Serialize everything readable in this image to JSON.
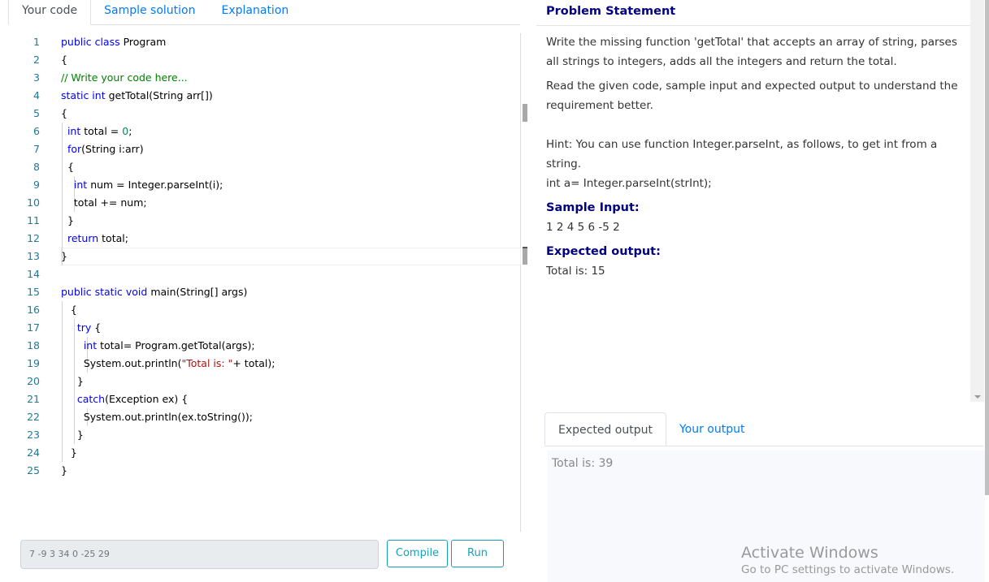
{
  "tabs": [
    "Your code",
    "Sample solution",
    "Explanation"
  ],
  "code": [
    [
      [
        "kw",
        "public class "
      ],
      [
        "pl",
        "Program"
      ]
    ],
    [
      [
        "pl",
        "{"
      ]
    ],
    [
      [
        "cm",
        "// Write your code here..."
      ]
    ],
    [
      [
        "kw",
        "static int "
      ],
      [
        "pl",
        "getTotal(String arr[])"
      ]
    ],
    [
      [
        "pl",
        "{"
      ]
    ],
    [
      [
        "pl",
        "  "
      ],
      [
        "kw",
        "int "
      ],
      [
        "pl",
        "total = "
      ],
      [
        "num",
        "0"
      ],
      [
        "pl",
        ";"
      ]
    ],
    [
      [
        "pl",
        "  "
      ],
      [
        "kw",
        "for"
      ],
      [
        "pl",
        "(String i:arr)"
      ]
    ],
    [
      [
        "pl",
        "  {"
      ]
    ],
    [
      [
        "pl",
        "    "
      ],
      [
        "kw",
        "int "
      ],
      [
        "pl",
        "num = Integer.parseInt(i);"
      ]
    ],
    [
      [
        "pl",
        "    total += num;"
      ]
    ],
    [
      [
        "pl",
        "  }"
      ]
    ],
    [
      [
        "pl",
        "  "
      ],
      [
        "kw",
        "return "
      ],
      [
        "pl",
        "total;"
      ]
    ],
    [
      [
        "pl",
        "}"
      ]
    ],
    [],
    [
      [
        "kw",
        "public static void "
      ],
      [
        "pl",
        "main(String[] args)"
      ]
    ],
    [
      [
        "pl",
        "   {"
      ]
    ],
    [
      [
        "pl",
        "     "
      ],
      [
        "kw",
        "try "
      ],
      [
        "pl",
        "{"
      ]
    ],
    [
      [
        "pl",
        "       "
      ],
      [
        "kw",
        "int "
      ],
      [
        "pl",
        "total= Program.getTotal(args);"
      ]
    ],
    [
      [
        "pl",
        "       System.out.println("
      ],
      [
        "str",
        "\"Total is: \""
      ],
      [
        "pl",
        "+ total);"
      ]
    ],
    [
      [
        "pl",
        "     }"
      ]
    ],
    [
      [
        "pl",
        "     "
      ],
      [
        "kw",
        "catch"
      ],
      [
        "pl",
        "(Exception ex) {"
      ]
    ],
    [
      [
        "pl",
        "       System.out.println(ex.toString());"
      ]
    ],
    [
      [
        "pl",
        "     }"
      ]
    ],
    [
      [
        "pl",
        "   }"
      ]
    ],
    [
      [
        "pl",
        "}"
      ]
    ]
  ],
  "input": {
    "value": "7 -9 3 34 0 -25 29"
  },
  "buttons": {
    "compile": "Compile",
    "run": "Run"
  },
  "problem": {
    "title": "Problem Statement",
    "p1": "Write the missing function 'getTotal' that accepts an array of string, parses all strings to integers, adds all the integers and return the total.",
    "p2": "Read the given code, sample input and expected output to understand the requirement better.",
    "hint1": "Hint: You can use function Integer.parseInt, as follows, to get int from a string.",
    "hint2": "int a= Integer.parseInt(strInt);",
    "sample_input_label": "Sample Input:",
    "sample_input": "1 2 4 5 6 -5 2",
    "expected_output_label": "Expected output:",
    "expected_output": "Total is: 15"
  },
  "output": {
    "tabs": [
      "Expected output",
      "Your output"
    ],
    "text": "Total is: 39"
  },
  "watermark": {
    "line1": "Activate Windows",
    "line2": "Go to PC settings to activate Windows."
  }
}
